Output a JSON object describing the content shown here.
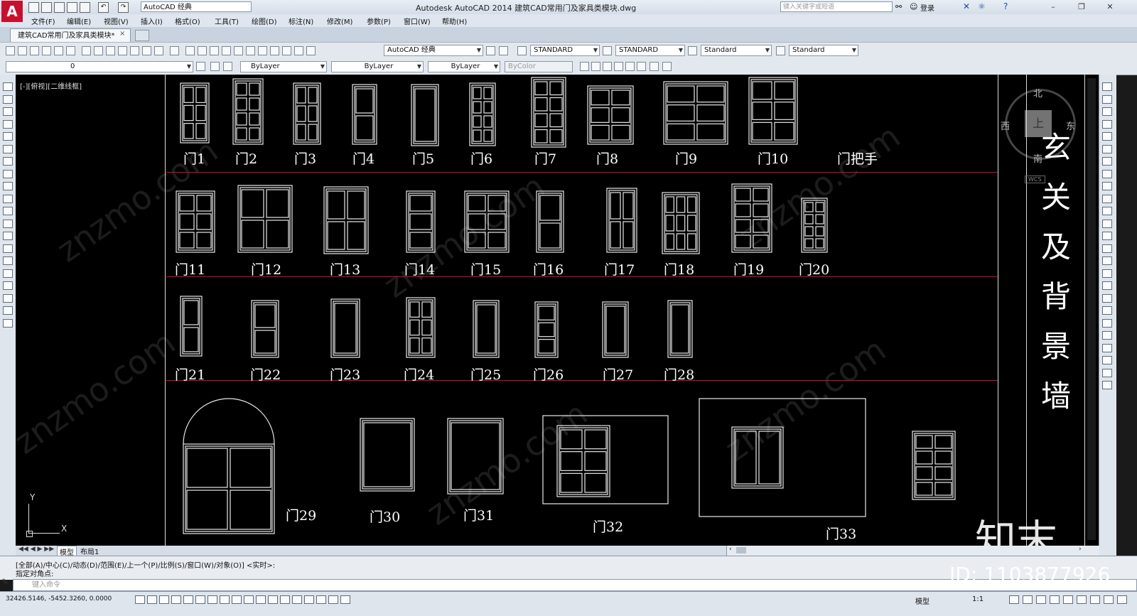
{
  "titlebar": {
    "workspace": "AutoCAD 经典",
    "title": "Autodesk AutoCAD 2014    建筑CAD常用门及家具类模块.dwg",
    "search_placeholder": "键入关键字或短语",
    "login": "登录"
  },
  "menu": [
    "文件(F)",
    "编辑(E)",
    "视图(V)",
    "插入(I)",
    "格式(O)",
    "工具(T)",
    "绘图(D)",
    "标注(N)",
    "修改(M)",
    "参数(P)",
    "窗口(W)",
    "帮助(H)"
  ],
  "doc_tab": "建筑CAD常用门及家具类模块*",
  "toolbar": {
    "workspace_combo": "AutoCAD 经典",
    "text_style": "STANDARD",
    "dim_style": "STANDARD",
    "table_style": "Standard",
    "mleader_style": "Standard",
    "layer": "0",
    "color": "ByLayer",
    "linetype": "ByLayer",
    "lineweight": "ByLayer",
    "plotstyle": "ByColor"
  },
  "viewport_label": "[-][俯视][二维线框]",
  "doors": {
    "row1": [
      "门1",
      "门2",
      "门3",
      "门4",
      "门5",
      "门6",
      "门7",
      "门8",
      "门9",
      "门10",
      "门把手"
    ],
    "row2": [
      "门11",
      "门12",
      "门13",
      "门14",
      "门15",
      "门16",
      "门17",
      "门18",
      "门19",
      "门20"
    ],
    "row3": [
      "门21",
      "门22",
      "门23",
      "门24",
      "门25",
      "门26",
      "门27",
      "门28"
    ],
    "row4": [
      "门29",
      "门30",
      "门31",
      "门32",
      "门33"
    ]
  },
  "side_title": [
    "玄",
    "关",
    "及",
    "背",
    "景",
    "墙"
  ],
  "viewcube": {
    "north": "北",
    "south": "南",
    "east": "东",
    "west": "西",
    "top": "上",
    "wcs": "WCS"
  },
  "ucs": {
    "x": "X",
    "y": "Y"
  },
  "watermarks": {
    "site": "znzmo.com",
    "brand": "知末",
    "id": "ID: 1103877926"
  },
  "layout_tabs": [
    "模型",
    "布局1"
  ],
  "command": {
    "history_line1": "[全部(A)/中心(C)/动态(D)/范围(E)/上一个(P)/比例(S)/窗口(W)/对象(O)] <实时>:",
    "history_line2": "指定对角点:",
    "input_placeholder": "键入命令"
  },
  "status": {
    "coords": "32426.5146, -5452.3260, 0.0000",
    "model": "模型",
    "scale": "1:1"
  },
  "colors": {
    "separator": "#c8102e",
    "canvas": "#000000",
    "logo": "#c8102e"
  }
}
